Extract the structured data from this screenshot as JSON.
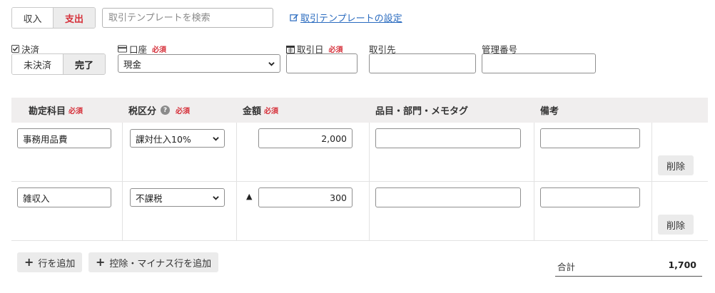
{
  "top": {
    "toggle_income": "収入",
    "toggle_expense": "支出",
    "search_placeholder": "取引テンプレートを検索",
    "template_settings_link": "取引テンプレートの設定"
  },
  "fields": {
    "settlement_label": "決済",
    "settlement_unsettled": "未決済",
    "settlement_done": "完了",
    "account_label": "口座",
    "account_required": "必須",
    "account_value": "現金",
    "date_label": "取引日",
    "date_required": "必須",
    "partner_label": "取引先",
    "management_no_label": "管理番号"
  },
  "table": {
    "headers": {
      "account_item": "勘定科目",
      "account_item_required": "必須",
      "tax": "税区分",
      "tax_required": "必須",
      "amount": "金額",
      "amount_required": "必須",
      "tags": "品目・部門・メモタグ",
      "remarks": "備考"
    },
    "rows": [
      {
        "account_item": "事務用品費",
        "tax": "課対仕入10%",
        "minus_mark": "",
        "amount": "2,000",
        "tags": "",
        "remarks": "",
        "delete": "削除"
      },
      {
        "account_item": "雑収入",
        "tax": "不課税",
        "minus_mark": "▲",
        "amount": "300",
        "tags": "",
        "remarks": "",
        "delete": "削除"
      }
    ]
  },
  "footer": {
    "add_row": "行を追加",
    "add_minus_row": "控除・マイナス行を追加",
    "total_label": "合計",
    "total_value": "1,700"
  },
  "colors": {
    "accent_red": "#d6303a",
    "link_blue": "#2a6bbf",
    "header_bg": "#f0eeee"
  }
}
